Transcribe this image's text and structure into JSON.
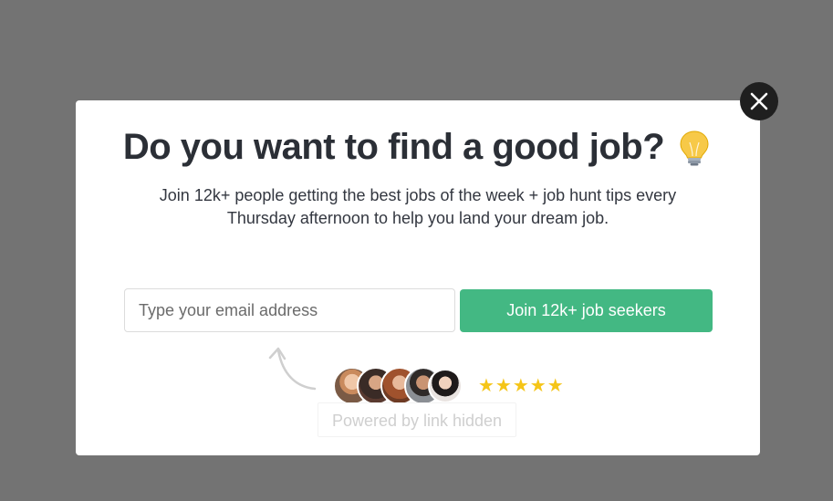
{
  "modal": {
    "title": "Do you want to find a good job?",
    "title_icon": "lightbulb-icon",
    "subtitle": "Join 12k+ people getting the best jobs of the week + job hunt tips every Thursday afternoon to help you land your dream job.",
    "email_placeholder": "Type your email address",
    "email_value": "",
    "submit_label": "Join 12k+ job seekers",
    "rating_stars": 5,
    "rating_display": "★★★★★",
    "powered_by": "Powered by link hidden",
    "avatars": [
      "avatar-1",
      "avatar-2",
      "avatar-3",
      "avatar-4",
      "avatar-5"
    ]
  },
  "colors": {
    "overlay": "#737373",
    "accent": "#43b883",
    "star": "#f5c518",
    "close_bg": "#1f1f1f"
  },
  "icons": {
    "close": "close-icon",
    "arrow": "curved-arrow-icon",
    "star": "star-icon"
  }
}
